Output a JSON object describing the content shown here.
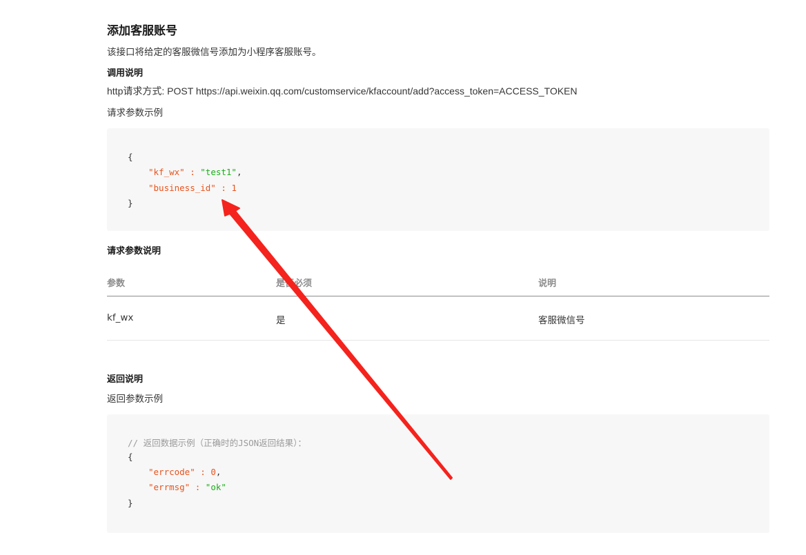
{
  "page": {
    "title": "添加客服账号",
    "description": "该接口将给定的客服微信号添加为小程序客服账号。",
    "call_heading": "调用说明",
    "http_line": "http请求方式: POST https://api.weixin.qq.com/customservice/kfaccount/add?access_token=ACCESS_TOKEN",
    "request_example_label": "请求参数示例",
    "request_code": {
      "open_brace": "{",
      "line1_key": "\"kf_wx\"",
      "line1_sep": " : ",
      "line1_val": "\"test1\"",
      "line1_end": ",",
      "line2_key": "\"business_id\"",
      "line2_sep": " : ",
      "line2_val": "1",
      "close_brace": "}"
    },
    "params_heading": "请求参数说明",
    "table": {
      "headers": [
        "参数",
        "是否必须",
        "说明"
      ],
      "rows": [
        [
          "kf_wx",
          "是",
          "客服微信号"
        ]
      ]
    },
    "return_heading": "返回说明",
    "return_example_label": "返回参数示例",
    "return_code": {
      "comment": "// 返回数据示例（正确时的JSON返回结果）：",
      "open_brace": "{",
      "line1_key": "\"errcode\"",
      "line1_sep": " : ",
      "line1_val": "0",
      "line1_end": ",",
      "line2_key": "\"errmsg\"",
      "line2_sep": " : ",
      "line2_val": "\"ok\"",
      "close_brace": "}"
    }
  },
  "annotation": {
    "arrow_color": "#f5231d"
  }
}
